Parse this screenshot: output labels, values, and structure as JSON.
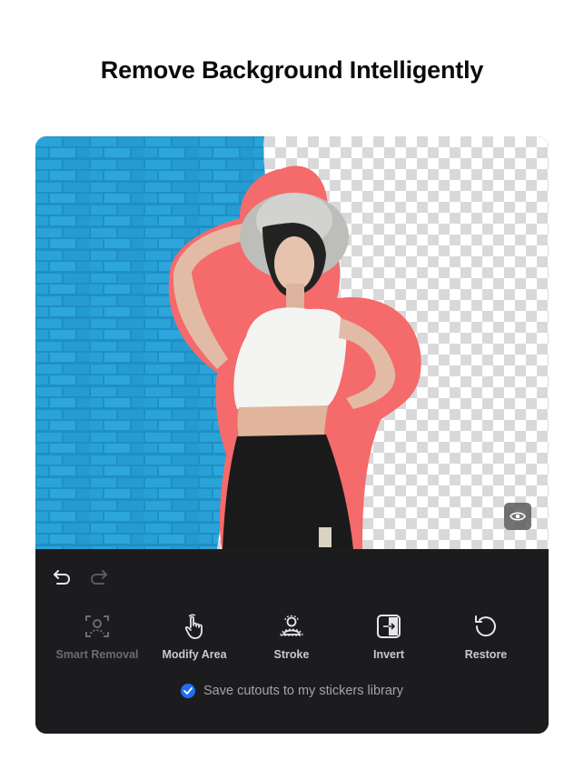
{
  "headline": "Remove Background Intelligently",
  "colors": {
    "toolbar_bg": "#1c1c1e",
    "accent_blue": "#1f6ff2",
    "stroke_outline": "#f56a6a",
    "brick_wall": "#1e90c8"
  },
  "editor": {
    "preview_button_icon": "eye-icon",
    "undo_icon": "undo-icon",
    "redo_icon": "redo-icon",
    "tools": [
      {
        "label": "Smart Removal",
        "icon": "smart-removal-icon",
        "enabled": false
      },
      {
        "label": "Modify Area",
        "icon": "hand-pointer-icon",
        "enabled": true
      },
      {
        "label": "Stroke",
        "icon": "stroke-person-icon",
        "enabled": true
      },
      {
        "label": "Invert",
        "icon": "invert-icon",
        "enabled": true
      },
      {
        "label": "Restore",
        "icon": "restore-icon",
        "enabled": true
      }
    ],
    "save_option": {
      "label": "Save cutouts to my stickers library",
      "checked": true
    }
  }
}
